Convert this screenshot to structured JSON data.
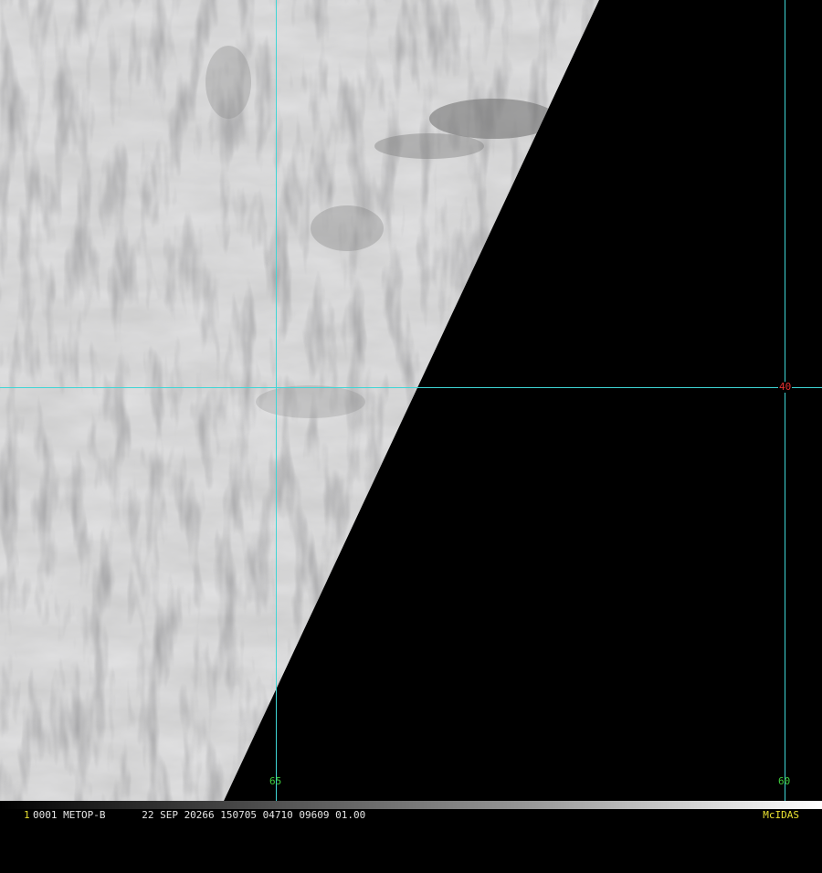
{
  "colors": {
    "gridline": "#3fd6d6",
    "lon_label": "#3ecb3e",
    "lat_label": "#e03030",
    "frame_number": "#e8e030",
    "brand": "#e8e030",
    "no_data": "#000000",
    "cloud": "#cfcfcf"
  },
  "grid": {
    "longitude_labels": [
      "65",
      "60"
    ],
    "latitude_labels": [
      "40"
    ]
  },
  "status_bar": {
    "frame_number": "1",
    "line": "0001 METOP-B      22 SEP 20266 150705 04710 09609 01.00",
    "brand": "McIDAS"
  }
}
